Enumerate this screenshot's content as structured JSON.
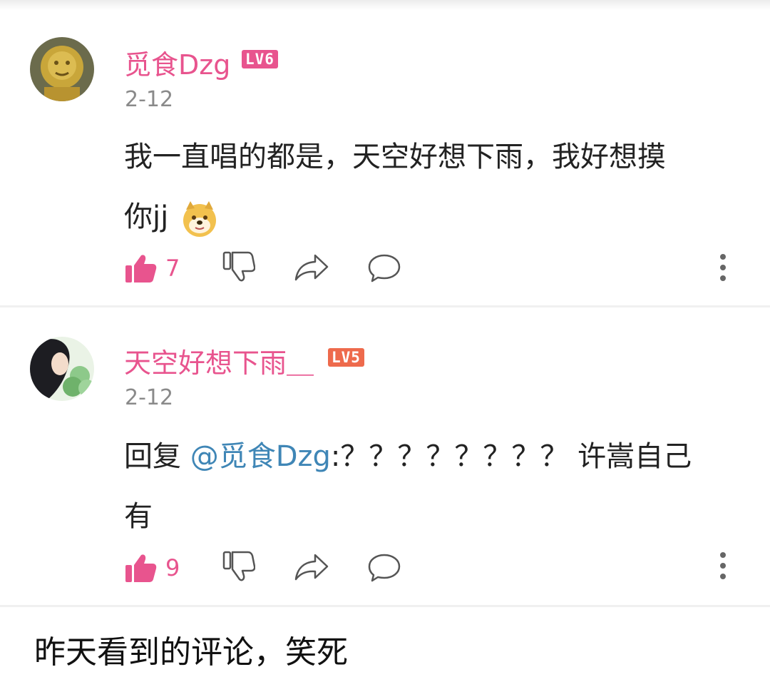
{
  "comments": [
    {
      "username": "觅食Dzg",
      "level": "LV6",
      "date": "2-12",
      "text_line1": "我一直唱的都是，天空好想下雨，我好想摸",
      "text_line2": "你jj",
      "emoji": "doge-emoji",
      "likes": "7"
    },
    {
      "username": "天空好想下雨＿",
      "level": "LV5",
      "date": "2-12",
      "reply_prefix": "回复",
      "mention": "@觅食Dzg",
      "reply_text": ":？？？？？？？？ 许嵩自己",
      "text_line2": "有",
      "likes": "9"
    }
  ],
  "caption": "昨天看到的评论，笑死",
  "colors": {
    "accent": "#e8548e",
    "mention": "#3f86b6",
    "level5": "#ee6a4c"
  },
  "icons": [
    "thumbs-up-icon",
    "thumbs-down-icon",
    "share-icon",
    "comment-icon",
    "more-icon"
  ]
}
